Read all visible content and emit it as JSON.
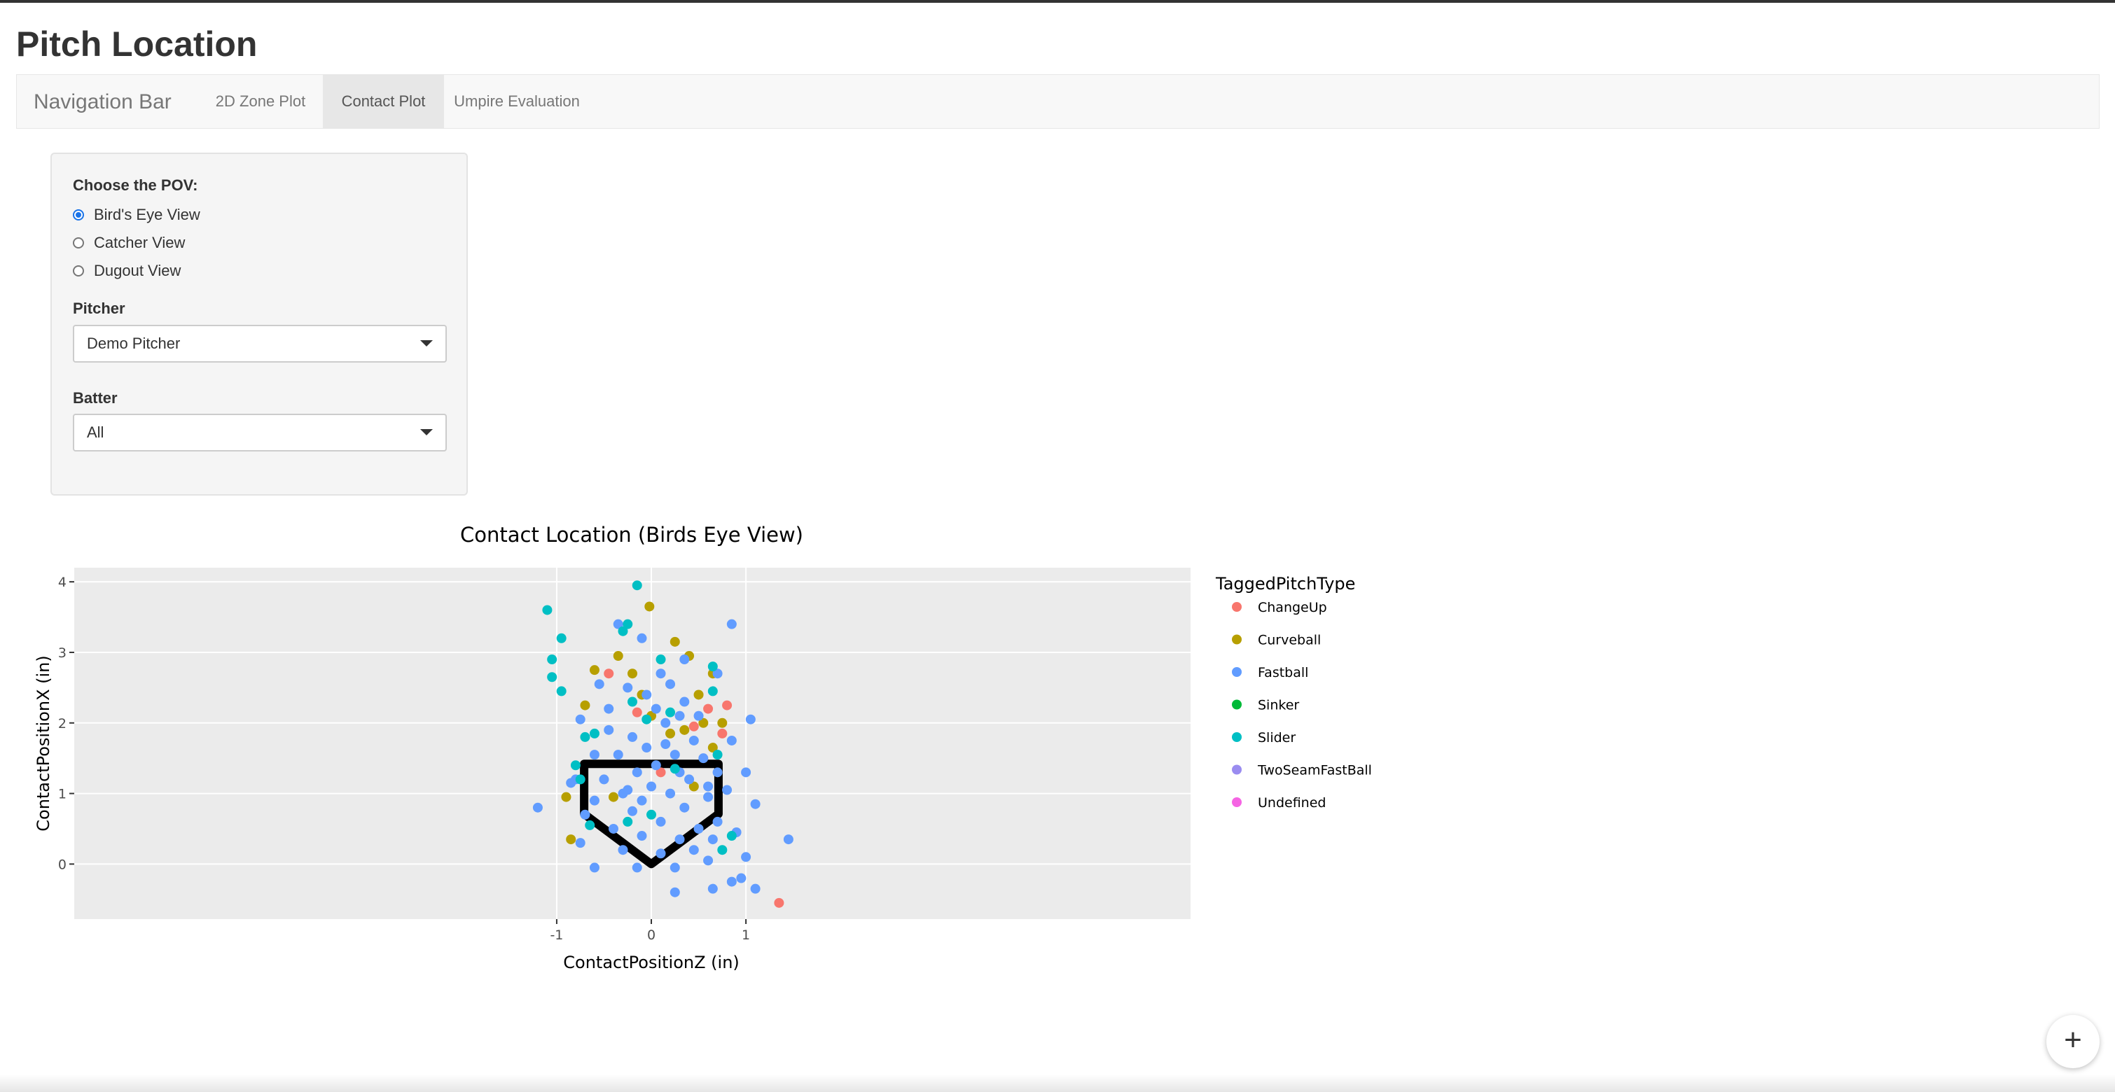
{
  "page": {
    "title": "Pitch Location"
  },
  "navbar": {
    "brand": "Navigation Bar",
    "tabs": [
      {
        "label": "2D Zone Plot",
        "active": false
      },
      {
        "label": "Contact Plot",
        "active": true
      },
      {
        "label": "Umpire Evaluation",
        "active": false
      }
    ]
  },
  "sidebar": {
    "pov_label": "Choose the POV:",
    "pov_options": [
      {
        "label": "Bird's Eye View",
        "selected": true
      },
      {
        "label": "Catcher View",
        "selected": false
      },
      {
        "label": "Dugout View",
        "selected": false
      }
    ],
    "pitcher_label": "Pitcher",
    "pitcher_value": "Demo Pitcher",
    "batter_label": "Batter",
    "batter_value": "All"
  },
  "fab": {
    "icon": "plus-icon",
    "label": "+"
  },
  "chart_data": {
    "type": "scatter",
    "title": "Contact Location (Birds Eye View)",
    "xlabel": "ContactPositionZ (in)",
    "ylabel": "ContactPositionX (in)",
    "xlim": [
      -6.1,
      5.7
    ],
    "ylim": [
      -0.78,
      4.2
    ],
    "xticks": [
      "-1",
      "0",
      "1"
    ],
    "yticks": [
      "0",
      "1",
      "2",
      "3",
      "4"
    ],
    "grid": true,
    "background": "#ebebeb",
    "legend": {
      "title": "TaggedPitchType",
      "position": "right"
    },
    "home_plate": [
      [
        -0.71,
        1.42
      ],
      [
        0.71,
        1.42
      ],
      [
        0.71,
        0.71
      ],
      [
        0.0,
        0.0
      ],
      [
        -0.71,
        0.71
      ],
      [
        -0.71,
        1.42
      ]
    ],
    "series": [
      {
        "name": "ChangeUp",
        "color": "#F8766D",
        "points": [
          [
            -0.45,
            2.7
          ],
          [
            -0.15,
            2.15
          ],
          [
            0.45,
            1.95
          ],
          [
            0.6,
            2.2
          ],
          [
            0.75,
            1.85
          ],
          [
            0.8,
            2.25
          ],
          [
            1.35,
            -0.55
          ],
          [
            0.1,
            1.3
          ]
        ]
      },
      {
        "name": "Curveball",
        "color": "#B79F00",
        "points": [
          [
            -0.02,
            3.65
          ],
          [
            0.25,
            3.15
          ],
          [
            -0.35,
            2.95
          ],
          [
            0.4,
            2.95
          ],
          [
            -0.6,
            2.75
          ],
          [
            -0.2,
            2.7
          ],
          [
            0.65,
            2.7
          ],
          [
            -0.7,
            2.25
          ],
          [
            0.0,
            2.1
          ],
          [
            0.55,
            2.0
          ],
          [
            0.75,
            2.0
          ],
          [
            0.35,
            1.9
          ],
          [
            0.65,
            1.65
          ],
          [
            -0.9,
            0.95
          ],
          [
            -0.85,
            0.35
          ],
          [
            0.45,
            1.1
          ],
          [
            -0.4,
            0.95
          ],
          [
            0.2,
            1.85
          ],
          [
            -0.1,
            2.4
          ],
          [
            0.5,
            2.4
          ]
        ]
      },
      {
        "name": "Fastball",
        "color": "#619CFF",
        "points": [
          [
            0.85,
            3.4
          ],
          [
            -0.35,
            3.4
          ],
          [
            -0.1,
            3.2
          ],
          [
            0.35,
            2.9
          ],
          [
            0.1,
            2.7
          ],
          [
            -0.25,
            2.5
          ],
          [
            0.2,
            2.55
          ],
          [
            0.7,
            2.7
          ],
          [
            -0.45,
            2.2
          ],
          [
            -0.55,
            2.55
          ],
          [
            0.35,
            2.3
          ],
          [
            0.05,
            2.2
          ],
          [
            1.05,
            2.05
          ],
          [
            -0.75,
            2.05
          ],
          [
            0.15,
            2.0
          ],
          [
            -0.2,
            1.8
          ],
          [
            0.45,
            1.75
          ],
          [
            0.85,
            1.75
          ],
          [
            -0.6,
            1.55
          ],
          [
            -0.35,
            1.55
          ],
          [
            -0.05,
            1.65
          ],
          [
            0.25,
            1.55
          ],
          [
            0.55,
            1.5
          ],
          [
            0.05,
            1.4
          ],
          [
            -0.15,
            1.3
          ],
          [
            0.3,
            1.3
          ],
          [
            0.7,
            1.3
          ],
          [
            -0.5,
            1.2
          ],
          [
            -0.8,
            1.2
          ],
          [
            0.0,
            1.1
          ],
          [
            0.4,
            1.2
          ],
          [
            1.0,
            1.3
          ],
          [
            -0.3,
            1.0
          ],
          [
            0.2,
            1.0
          ],
          [
            0.6,
            0.95
          ],
          [
            -0.6,
            0.9
          ],
          [
            1.1,
            0.85
          ],
          [
            -1.2,
            0.8
          ],
          [
            -0.2,
            0.75
          ],
          [
            0.35,
            0.8
          ],
          [
            -0.7,
            0.7
          ],
          [
            0.1,
            0.6
          ],
          [
            0.7,
            0.6
          ],
          [
            -0.4,
            0.5
          ],
          [
            0.5,
            0.5
          ],
          [
            -0.1,
            0.4
          ],
          [
            0.3,
            0.35
          ],
          [
            0.9,
            0.45
          ],
          [
            -0.75,
            0.3
          ],
          [
            0.65,
            0.35
          ],
          [
            1.45,
            0.35
          ],
          [
            -0.3,
            0.2
          ],
          [
            0.45,
            0.2
          ],
          [
            0.1,
            0.15
          ],
          [
            1.0,
            0.1
          ],
          [
            -0.6,
            -0.05
          ],
          [
            0.6,
            0.05
          ],
          [
            -0.15,
            -0.05
          ],
          [
            0.25,
            -0.05
          ],
          [
            0.85,
            -0.25
          ],
          [
            0.95,
            -0.2
          ],
          [
            1.1,
            -0.35
          ],
          [
            0.25,
            -0.4
          ],
          [
            0.65,
            -0.35
          ],
          [
            -0.25,
            1.05
          ],
          [
            0.15,
            1.7
          ],
          [
            0.5,
            2.1
          ],
          [
            -0.05,
            2.4
          ],
          [
            0.3,
            2.1
          ],
          [
            -0.45,
            1.9
          ],
          [
            0.6,
            1.1
          ],
          [
            -0.1,
            0.9
          ],
          [
            0.8,
            1.05
          ],
          [
            -0.85,
            1.15
          ]
        ]
      },
      {
        "name": "Sinker",
        "color": "#00BA38",
        "points": []
      },
      {
        "name": "Slider",
        "color": "#00BFC4",
        "points": [
          [
            -0.15,
            3.95
          ],
          [
            -1.1,
            3.6
          ],
          [
            -0.95,
            3.2
          ],
          [
            -0.25,
            3.4
          ],
          [
            -0.3,
            3.3
          ],
          [
            -1.05,
            2.9
          ],
          [
            -1.05,
            2.65
          ],
          [
            -0.95,
            2.45
          ],
          [
            0.65,
            2.8
          ],
          [
            -0.7,
            1.8
          ],
          [
            -0.6,
            1.85
          ],
          [
            -0.8,
            1.4
          ],
          [
            -0.75,
            1.2
          ],
          [
            0.1,
            2.9
          ],
          [
            0.65,
            2.45
          ],
          [
            -0.05,
            2.05
          ],
          [
            0.2,
            2.15
          ],
          [
            0.0,
            0.7
          ],
          [
            -0.25,
            0.6
          ],
          [
            0.85,
            0.4
          ],
          [
            0.75,
            0.2
          ],
          [
            -0.65,
            0.55
          ],
          [
            -0.2,
            2.3
          ],
          [
            0.7,
            1.55
          ],
          [
            0.25,
            1.35
          ]
        ]
      },
      {
        "name": "TwoSeamFastBall",
        "color": "#9A8CF0",
        "points": []
      },
      {
        "name": "Undefined",
        "color": "#F564E3",
        "points": []
      }
    ]
  }
}
